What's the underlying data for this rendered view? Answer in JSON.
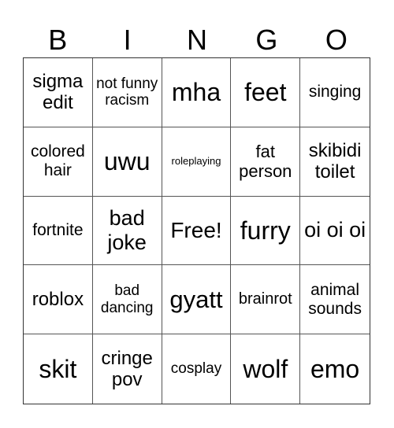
{
  "header": [
    "B",
    "I",
    "N",
    "G",
    "O"
  ],
  "cells": [
    {
      "text": "sigma edit",
      "size": 24
    },
    {
      "text": "not funny racism",
      "size": 19
    },
    {
      "text": "mha",
      "size": 32
    },
    {
      "text": "feet",
      "size": 32
    },
    {
      "text": "singing",
      "size": 21
    },
    {
      "text": "colored hair",
      "size": 21
    },
    {
      "text": "uwu",
      "size": 32
    },
    {
      "text": "roleplaying",
      "size": 13
    },
    {
      "text": "fat person",
      "size": 22
    },
    {
      "text": "skibidi toilet",
      "size": 24
    },
    {
      "text": "fortnite",
      "size": 21
    },
    {
      "text": "bad joke",
      "size": 27
    },
    {
      "text": "Free!",
      "size": 28
    },
    {
      "text": "furry",
      "size": 32
    },
    {
      "text": "oi oi oi",
      "size": 27
    },
    {
      "text": "roblox",
      "size": 24
    },
    {
      "text": "bad dancing",
      "size": 19
    },
    {
      "text": "gyatt",
      "size": 31
    },
    {
      "text": "brainrot",
      "size": 20
    },
    {
      "text": "animal sounds",
      "size": 21
    },
    {
      "text": "skit",
      "size": 32
    },
    {
      "text": "cringe pov",
      "size": 24
    },
    {
      "text": "cosplay",
      "size": 19
    },
    {
      "text": "wolf",
      "size": 32
    },
    {
      "text": "emo",
      "size": 32
    }
  ]
}
